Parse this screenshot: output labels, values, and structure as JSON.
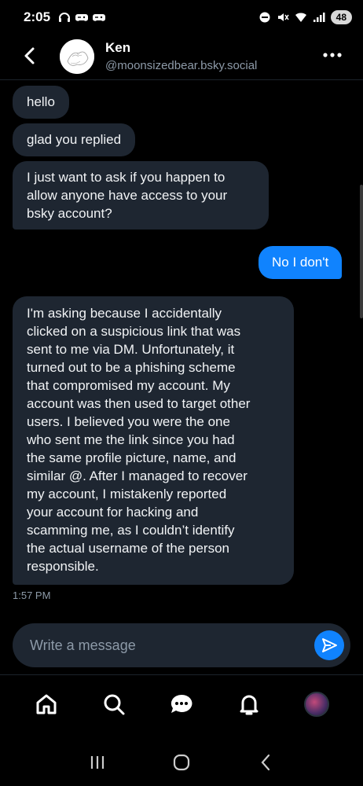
{
  "status_bar": {
    "time": "2:05",
    "battery": "48",
    "left_icons": [
      "headphones-icon",
      "gamepad-icon",
      "gamepad-icon"
    ],
    "right_icons": [
      "do-not-disturb-icon",
      "mute-icon",
      "wifi-icon",
      "signal-icon"
    ]
  },
  "header": {
    "name": "Ken",
    "handle": "@moonsizedbear.bsky.social"
  },
  "messages": [
    {
      "direction": "in",
      "text": "hello"
    },
    {
      "direction": "in",
      "text": "glad you replied"
    },
    {
      "direction": "in",
      "lines": [
        "I just want to ask if you happen to",
        "allow anyone have access to your",
        "bsky account?"
      ]
    },
    {
      "direction": "out",
      "text": "No I don't"
    },
    {
      "direction": "in",
      "lines": [
        "I'm asking because I accidentally",
        "clicked on a suspicious link that was",
        "sent to me via DM. Unfortunately, it",
        "turned out to be a phishing scheme",
        "that compromised my account. My",
        "account was then used to target other",
        "users. I believed you were the one",
        "who sent me the link since you had",
        "the same profile picture, name, and",
        "similar @. After I managed to recover",
        "my account, I mistakenly reported",
        "your account for hacking and",
        "scamming me, as I couldn’t identify",
        "the actual username of the person",
        "responsible."
      ]
    }
  ],
  "last_message_time": "1:57 PM",
  "composer": {
    "placeholder": "Write a message",
    "value": ""
  },
  "bottom_nav": [
    "home-icon",
    "search-icon",
    "chat-icon",
    "notifications-icon",
    "profile-avatar"
  ],
  "colors": {
    "background": "#000000",
    "bubble_in": "#1e2631",
    "bubble_out": "#1083fe",
    "muted_text": "#8d9aa8"
  }
}
